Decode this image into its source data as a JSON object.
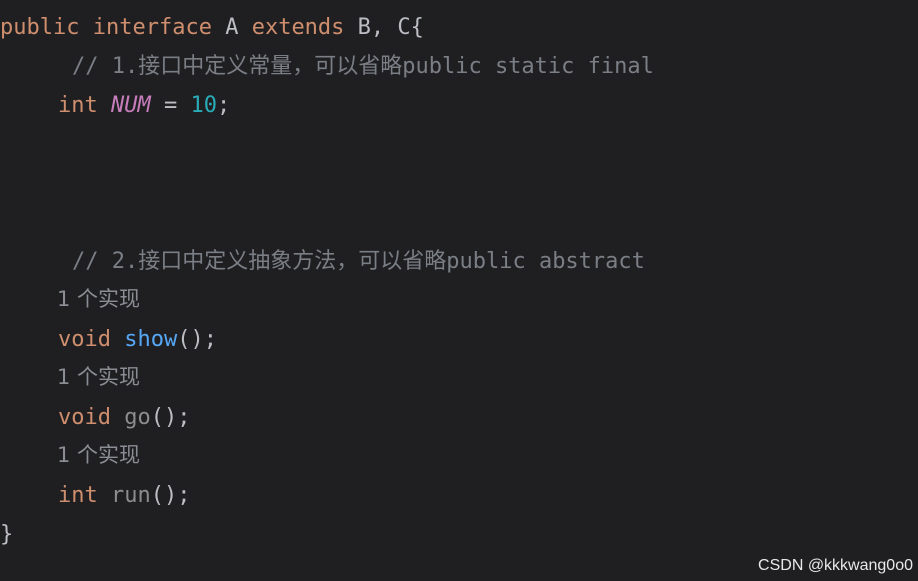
{
  "code": {
    "decl": {
      "public": "public",
      "interface": "interface",
      "name": "A",
      "extends": "extends",
      "parents": "B, C",
      "brace_open": "{"
    },
    "comment1": "// 1.接口中定义常量，可以省略public static final",
    "constant": {
      "type": "int",
      "name": "NUM",
      "eq": " = ",
      "value": "10",
      "semicolon": ";"
    },
    "comment2": "// 2.接口中定义抽象方法，可以省略public abstract",
    "methods": [
      {
        "hint": "1 个实现",
        "return_type": "void",
        "name": "show",
        "params": "();"
      },
      {
        "hint": "1 个实现",
        "return_type": "void",
        "name": "go",
        "params": "();"
      },
      {
        "hint": "1 个实现",
        "return_type": "int",
        "name": "run",
        "params": "();"
      }
    ],
    "brace_close": "}"
  },
  "watermark": "CSDN @kkkwang0o0",
  "colors": {
    "background": "#1f1f22",
    "keyword": "#cf8e6d",
    "constant": "#c77dbb",
    "number": "#2aacb8",
    "method_declaration": "#56a8f5",
    "comment": "#7a7e85"
  }
}
